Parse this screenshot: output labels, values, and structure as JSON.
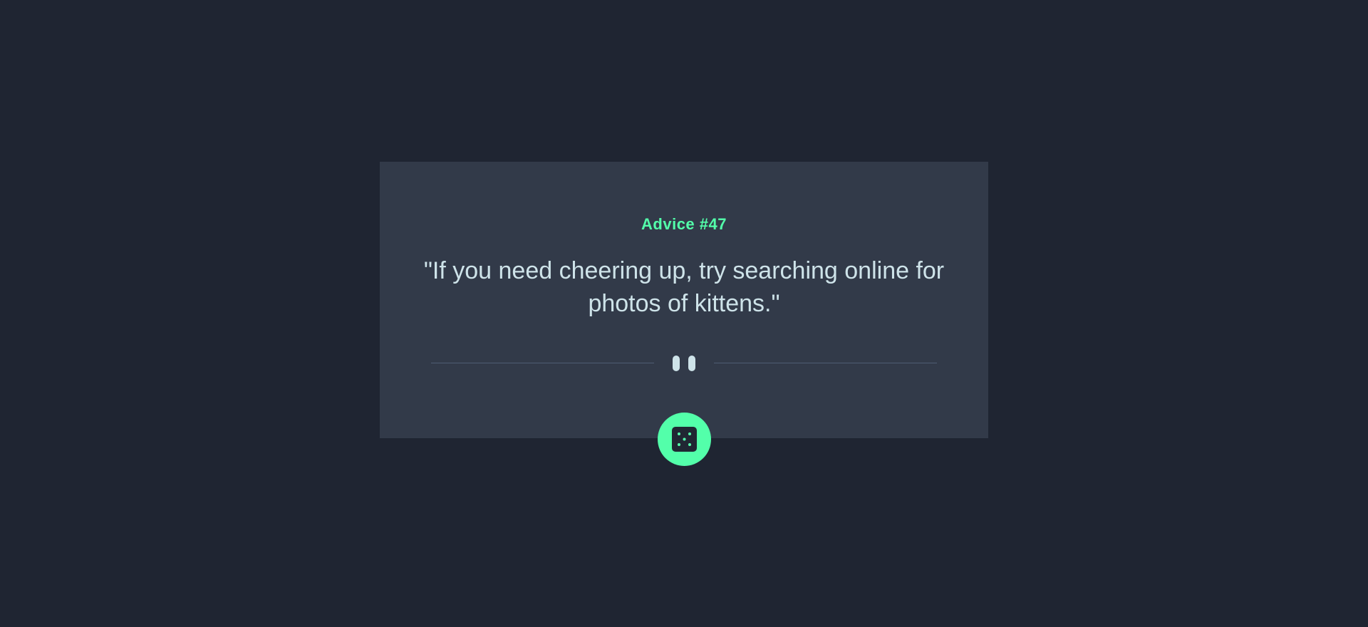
{
  "advice": {
    "id_label": "Advice #47",
    "text": "\"If you need cheering up, try searching online for photos of kittens.\""
  },
  "divider": {
    "icon": "pause-icon"
  },
  "button": {
    "icon": "dice-icon"
  },
  "colors": {
    "background": "#1f2532",
    "card": "#323a49",
    "accent": "#53ffaa",
    "text": "#cee3e9",
    "divider": "#4f5d74"
  }
}
